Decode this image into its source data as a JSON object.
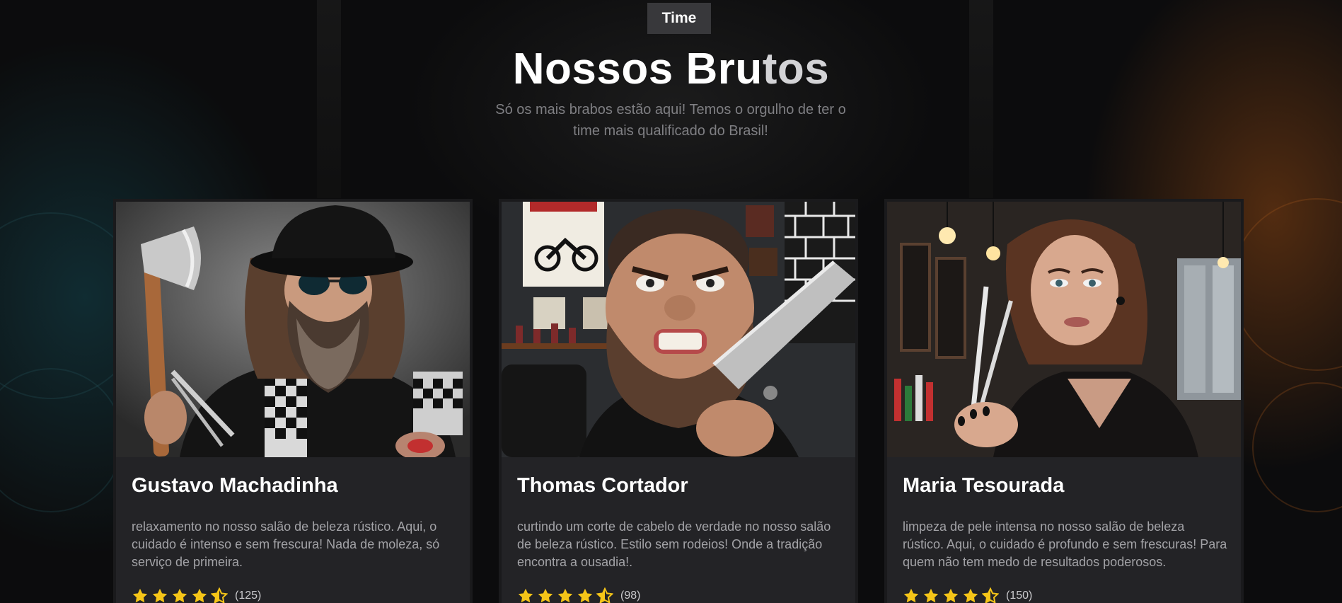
{
  "section": {
    "badge": "Time",
    "title_main": "Nossos Bru",
    "title_fade": "tos",
    "subtitle": "Só os mais brabos estão aqui! Temos o orgulho de ter o time mais qualificado do Brasil!"
  },
  "team": [
    {
      "name": "Gustavo Machadinha",
      "description": "relaxamento no nosso salão de beleza rústico. Aqui, o cuidado é intenso e sem frescura! Nada de moleza, só serviço de primeira.",
      "rating": 4.5,
      "reviews": "(125)",
      "photo_icon": "bearded-barber-with-axe-photo"
    },
    {
      "name": "Thomas Cortador",
      "description": "curtindo um corte de cabelo de verdade no nosso salão de beleza rústico. Estilo sem rodeios! Onde a tradição encontra a ousadia!.",
      "rating": 4.5,
      "reviews": "(98)",
      "photo_icon": "angry-barber-with-razor-photo"
    },
    {
      "name": "Maria Tesourada",
      "description": "limpeza de pele intensa no nosso salão de beleza rústico. Aqui, o cuidado é profundo e sem frescuras! Para quem não tem medo de resultados poderosos.",
      "rating": 4.5,
      "reviews": "(150)",
      "photo_icon": "woman-barber-with-scissors-photo"
    }
  ],
  "colors": {
    "background": "#0c0c0d",
    "card": "#232326",
    "badge": "#38383b",
    "star": "#f5c518",
    "text_primary": "#ffffff",
    "text_muted": "#a3a3a7"
  }
}
